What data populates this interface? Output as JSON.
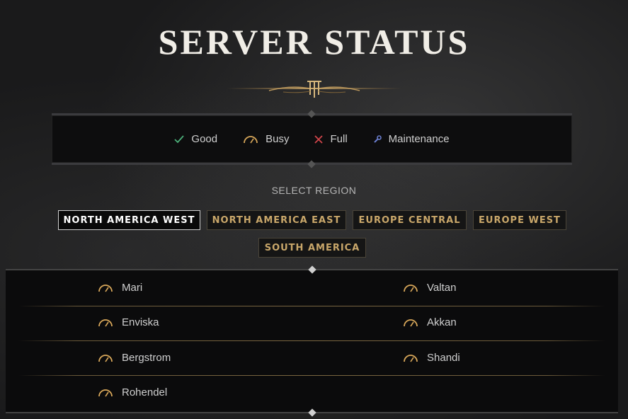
{
  "page": {
    "title": "SERVER STATUS"
  },
  "legend": {
    "items": [
      {
        "label": "Good",
        "icon": "check-icon",
        "color": "#4cb07a"
      },
      {
        "label": "Busy",
        "icon": "gauge-icon",
        "color": "#d9a85a"
      },
      {
        "label": "Full",
        "icon": "x-icon",
        "color": "#d0454a"
      },
      {
        "label": "Maintenance",
        "icon": "wrench-icon",
        "color": "#6b7fd0"
      }
    ]
  },
  "region": {
    "label": "SELECT REGION",
    "tabs": [
      {
        "label": "NORTH AMERICA WEST",
        "active": true
      },
      {
        "label": "NORTH AMERICA EAST",
        "active": false
      },
      {
        "label": "EUROPE CENTRAL",
        "active": false
      },
      {
        "label": "EUROPE WEST",
        "active": false
      },
      {
        "label": "SOUTH AMERICA",
        "active": false
      }
    ]
  },
  "servers": [
    {
      "name": "Mari",
      "status": "Busy"
    },
    {
      "name": "Valtan",
      "status": "Busy"
    },
    {
      "name": "Enviska",
      "status": "Busy"
    },
    {
      "name": "Akkan",
      "status": "Busy"
    },
    {
      "name": "Bergstrom",
      "status": "Busy"
    },
    {
      "name": "Shandi",
      "status": "Busy"
    },
    {
      "name": "Rohendel",
      "status": "Busy"
    }
  ]
}
